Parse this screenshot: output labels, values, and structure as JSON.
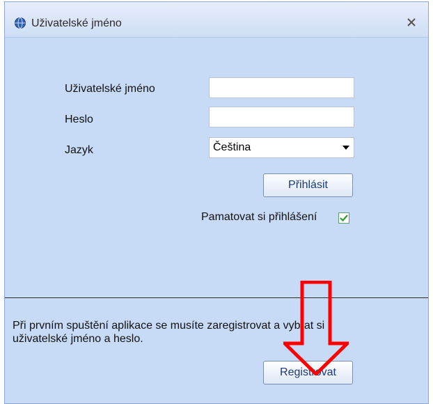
{
  "window": {
    "title": "Uživatelské jméno"
  },
  "form": {
    "username_label": "Uživatelské jméno",
    "username_value": "",
    "password_label": "Heslo",
    "password_value": "",
    "language_label": "Jazyk",
    "language_selected": "Čeština",
    "login_button": "Přihlásit",
    "remember_label": "Pamatovat si přihlášení",
    "remember_checked": true
  },
  "registration": {
    "info": "Při prvním spuštění aplikace se musíte zaregistrovat a vybrat si uživatelské jméno a heslo.",
    "register_button": "Registrovat"
  },
  "colors": {
    "annotation_arrow": "#ff0000",
    "window_bg": "#c7daf6"
  },
  "icons": {
    "title": "globe-icon",
    "close": "close-icon",
    "check": "checkmark-icon",
    "dropdown": "chevron-down-icon"
  }
}
